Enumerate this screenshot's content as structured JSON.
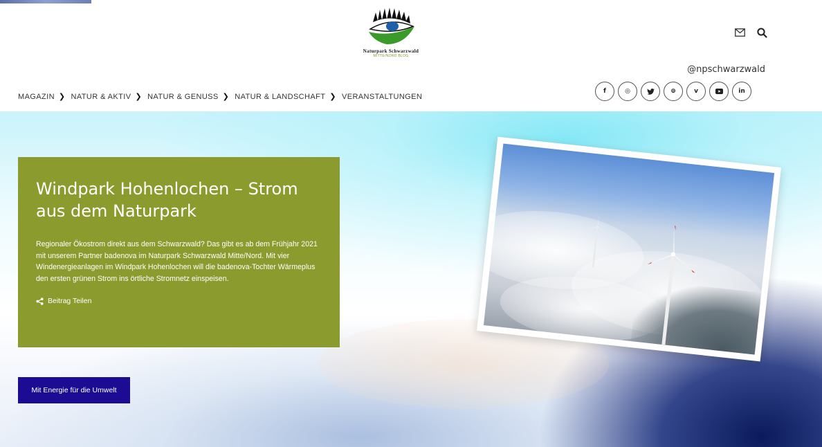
{
  "header": {
    "logo_title": "Naturpark Schwarzwald",
    "logo_subtitle": "MITTE/NORD BLOG",
    "handle": "@npschwarzwald"
  },
  "nav": {
    "items": [
      "MAGAZIN",
      "NATUR & AKTIV",
      "NATUR & GENUSS",
      "NATUR & LANDSCHAFT",
      "VERANSTALTUNGEN"
    ],
    "separator": "❯"
  },
  "social": {
    "items": [
      {
        "label": "f",
        "icon": "facebook-icon"
      },
      {
        "label": "◎",
        "icon": "instagram-icon"
      },
      {
        "label": "🐦",
        "icon": "twitter-icon"
      },
      {
        "label": "⊚",
        "icon": "pinterest-icon"
      },
      {
        "label": "v",
        "icon": "vimeo-icon"
      },
      {
        "label": "▶",
        "icon": "youtube-icon"
      },
      {
        "label": "in",
        "icon": "linkedin-icon"
      }
    ]
  },
  "hero": {
    "title": "Windpark Hohenlochen – Strom aus dem Naturpark",
    "text": "Regionaler Ökostrom direkt aus dem Schwarzwald? Das gibt es ab dem Frühjahr 2021 mit unserem Partner badenova im Naturpark Schwarzwald Mitte/Nord. Mit vier Windenergieanlagen im Windpark Hohenlochen will die badenova-Tochter Wärmeplus den ersten grünen Strom ins örtliche Stromnetz einspeisen.",
    "share_label": "Beitrag Teilen",
    "cta_label": "Mit Energie für die Umwelt"
  },
  "colors": {
    "intro_box": "#8c9b2e",
    "cta": "#1c0c93",
    "logo_green": "#3a9a2a",
    "logo_blue": "#1d5fa8"
  }
}
